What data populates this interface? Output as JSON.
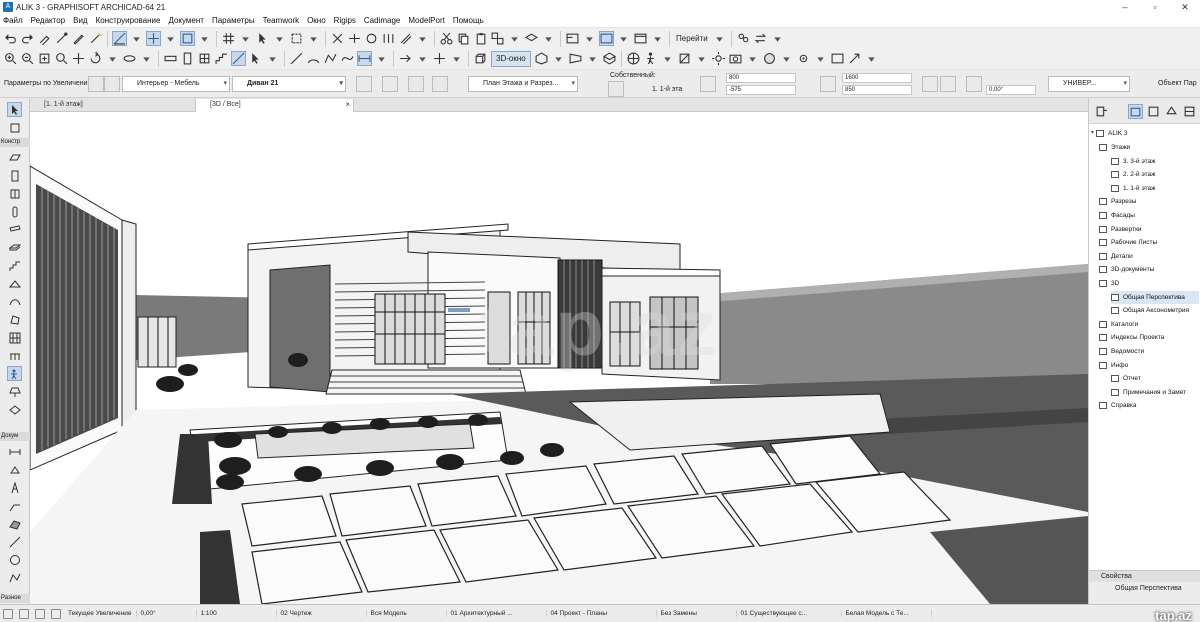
{
  "window": {
    "title": "ALIK 3 - GRAPHISOFT ARCHICAD-64 21",
    "app_icon": "archicad-icon"
  },
  "menu": [
    "Файл",
    "Редактор",
    "Вид",
    "Конструирование",
    "Документ",
    "Параметры",
    "Teamwork",
    "Окно",
    "Rigips",
    "Cadimage",
    "ModelPort",
    "Помощь"
  ],
  "toolbar": {
    "goto_label": "Перейти",
    "view3d_label": "3D-окно"
  },
  "infobox": {
    "settings_label": "Параметры по Увеличению",
    "layer": "Интерьер - Мебель",
    "object_name": "Диван 21",
    "view_mode": "План Этажа и Разрез...",
    "own_label": "Собственный:",
    "story_label": "1. 1-й эта",
    "dim1": "800",
    "dim2": "-575",
    "dim3": "1600",
    "dim4": "850",
    "angle": "0,00°",
    "category": "УНИВЕР...",
    "object_param": "Объект Пар"
  },
  "tabs": [
    {
      "label": "[1. 1-й этаж]"
    },
    {
      "label": "[3D / Все]"
    }
  ],
  "toolbox": {
    "design_header": "Констр",
    "document_header": "Докум",
    "more_header": "Разное"
  },
  "navigator": {
    "project": "ALIK 3",
    "items": [
      {
        "label": "Этажи",
        "level": 1
      },
      {
        "label": "3. 3-й этаж",
        "level": 2
      },
      {
        "label": "2. 2-й этаж",
        "level": 2
      },
      {
        "label": "1. 1-й этаж",
        "level": 2
      },
      {
        "label": "Разрезы",
        "level": 1
      },
      {
        "label": "Фасады",
        "level": 1
      },
      {
        "label": "Развертки",
        "level": 1
      },
      {
        "label": "Рабочие Листы",
        "level": 1
      },
      {
        "label": "Детали",
        "level": 1
      },
      {
        "label": "3D-документы",
        "level": 1
      },
      {
        "label": "3D",
        "level": 1
      },
      {
        "label": "Общая Перспектива",
        "level": 2,
        "selected": true
      },
      {
        "label": "Общая Аксонометрия",
        "level": 2
      },
      {
        "label": "Каталоги",
        "level": 1
      },
      {
        "label": "Индексы Проекта",
        "level": 1
      },
      {
        "label": "Ведомости",
        "level": 1
      },
      {
        "label": "Инфо",
        "level": 1
      },
      {
        "label": "Отчет",
        "level": 2
      },
      {
        "label": "Примечания и Замет",
        "level": 2
      },
      {
        "label": "Справка",
        "level": 1
      }
    ]
  },
  "properties": {
    "header": "Свойства",
    "value": "Общая Перспектива"
  },
  "statusbar": {
    "zoom_label": "Текущее Увеличение",
    "angle": "0,00°",
    "scale": "1:100",
    "layer_combo": "02 Чертеж",
    "model_view": "Вся Модель",
    "pen_set": "01 Архитектурный ...",
    "graphic_override": "04 Проект - Планы",
    "renovation": "Без Замены",
    "renovation_filter": "01 Существующее с...",
    "style": "Белая Модель с Те..."
  },
  "watermark": "tap.az",
  "viewport_watermark": "tap.az"
}
